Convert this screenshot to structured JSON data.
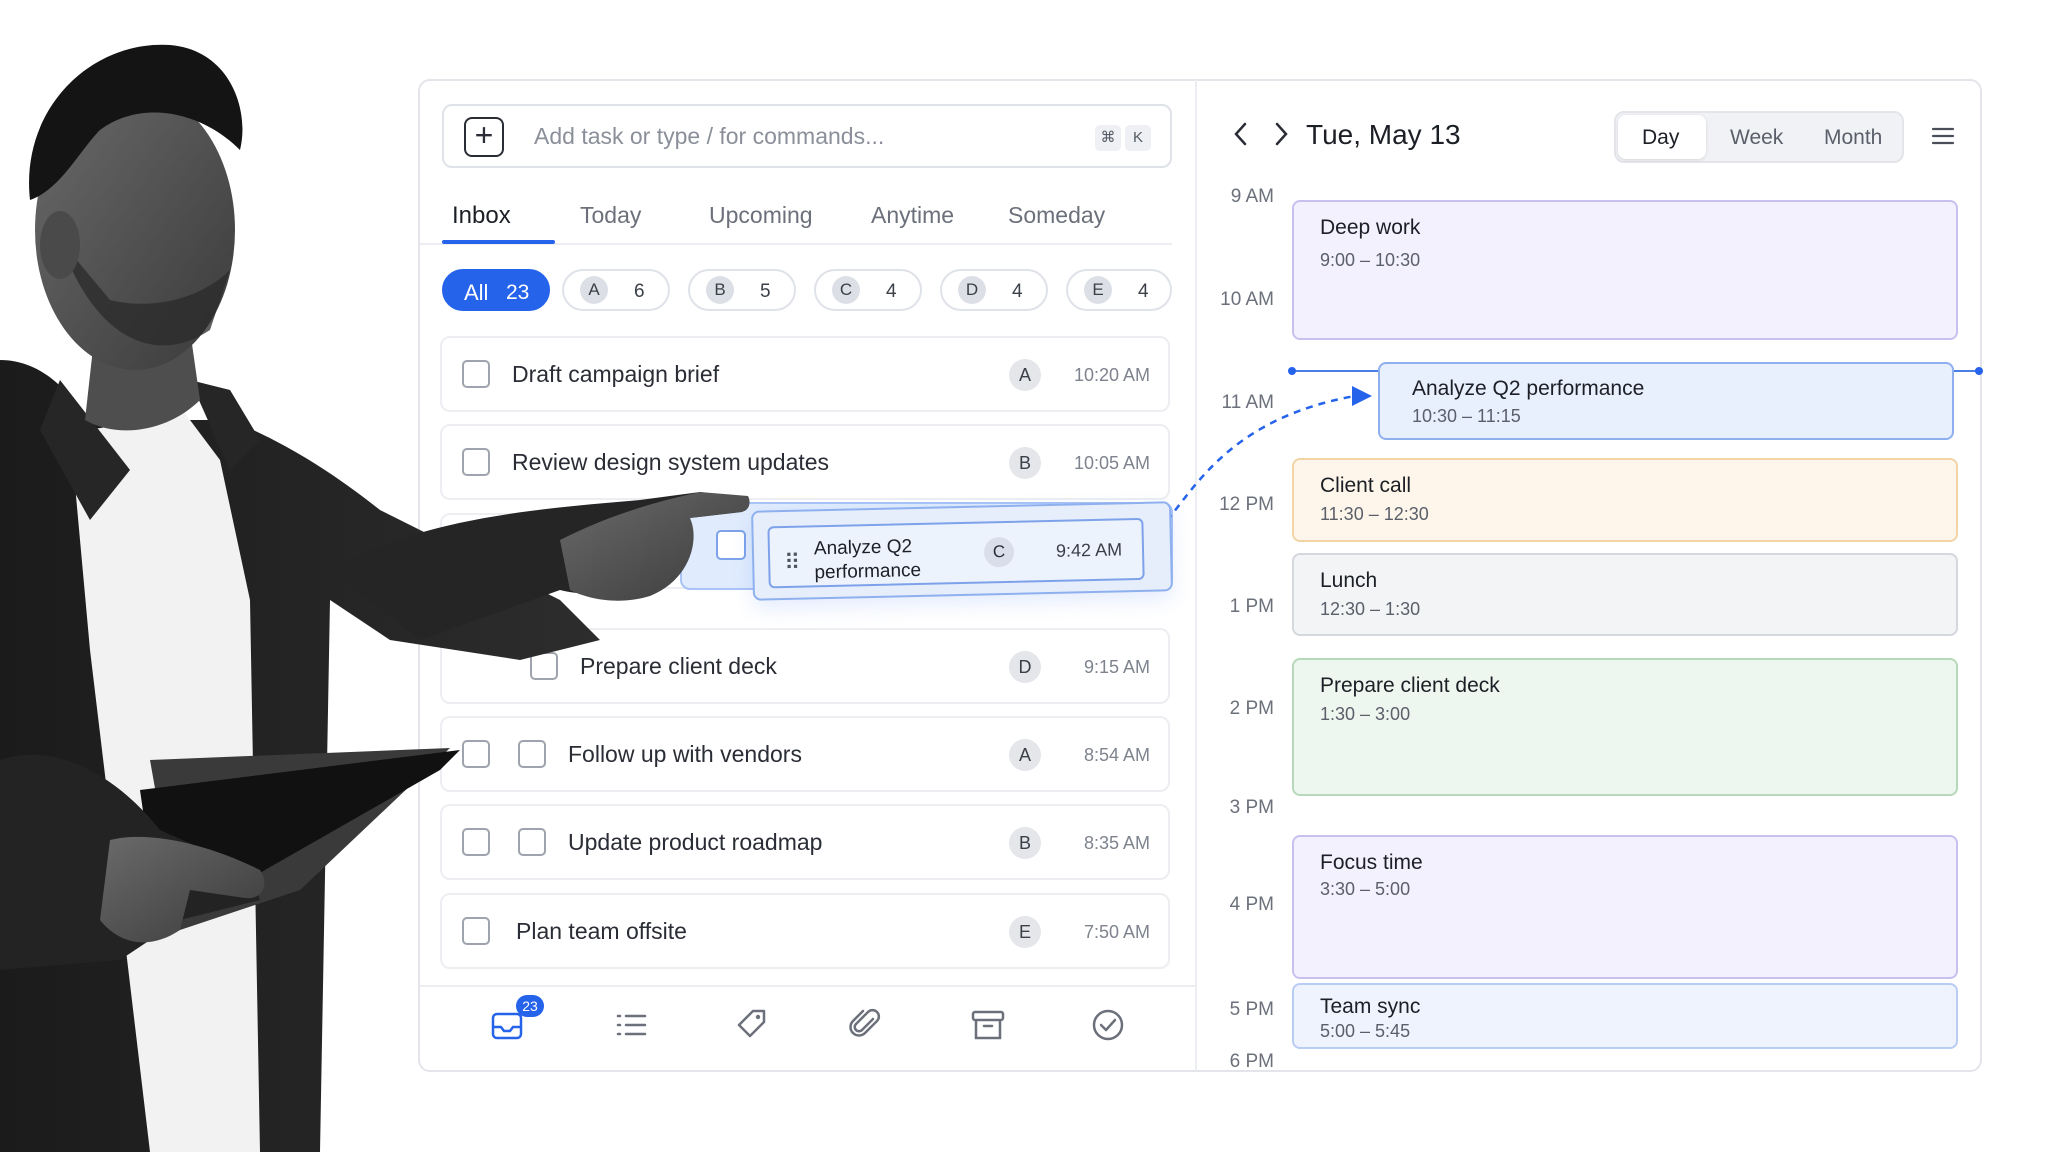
{
  "command_bar": {
    "placeholder": "Add task or type / for commands...",
    "shortcut": [
      "⌘",
      "K"
    ]
  },
  "tabs": [
    {
      "label": "Inbox",
      "active": true
    },
    {
      "label": "Today"
    },
    {
      "label": "Upcoming"
    },
    {
      "label": "Anytime"
    },
    {
      "label": "Someday"
    }
  ],
  "filters": [
    {
      "label": "All",
      "count": "23",
      "active": true
    },
    {
      "label": "A",
      "count": "6"
    },
    {
      "label": "B",
      "count": "5"
    },
    {
      "label": "C",
      "count": "4"
    },
    {
      "label": "D",
      "count": "4"
    },
    {
      "label": "E",
      "count": "4"
    }
  ],
  "tasks": [
    {
      "title": "Draft campaign brief",
      "priority": "A",
      "time": "10:20 AM"
    },
    {
      "title": "Review design system updates",
      "priority": "B",
      "time": "10:05 AM"
    },
    {
      "title": "Prepare client deck",
      "priority": "D",
      "time": "9:15 AM"
    },
    {
      "title": "Follow up with vendors",
      "priority": "A",
      "time": "8:54 AM"
    },
    {
      "title": "Update product roadmap",
      "priority": "B",
      "time": "8:35 AM"
    },
    {
      "title": "Plan team offsite",
      "priority": "E",
      "time": "7:50 AM"
    }
  ],
  "dragging_task": {
    "title": "Analyze Q2 performance",
    "priority": "C",
    "time": "9:42 AM"
  },
  "toolbar": {
    "inbox_badge": "23",
    "icons": [
      "inbox-icon",
      "list-icon",
      "tag-icon",
      "paperclip-icon",
      "archive-icon",
      "check-circle-icon"
    ]
  },
  "calendar": {
    "date": "Tue, May 13",
    "views": [
      "Day",
      "Week",
      "Month"
    ],
    "selected_view": "Day",
    "hours": [
      "9 AM",
      "10 AM",
      "11 AM",
      "12 PM",
      "1 PM",
      "2 PM",
      "3 PM",
      "4 PM",
      "5 PM",
      "6 PM"
    ],
    "events": [
      {
        "title": "Deep work",
        "time": "9:00 – 10:30",
        "color": "#c9c0f0"
      },
      {
        "title": "Analyze Q2  performance",
        "time": "10:30 – 11:15",
        "color": "#8fb0ef"
      },
      {
        "title": "Client call",
        "time": "11:30 – 12:30",
        "color": "#f2d4a6"
      },
      {
        "title": "Lunch",
        "time": "12:30 – 1:30",
        "color": "#d4d7dd"
      },
      {
        "title": "Prepare client deck",
        "time": "1:30 – 3:00",
        "color": "#b5d9b9"
      },
      {
        "title": "Focus time",
        "time": "3:30 – 5:00",
        "color": "#c9c0f0"
      },
      {
        "title": "Team sync",
        "time": "5:00 – 5:45",
        "color": "#b9ccf3"
      }
    ]
  },
  "colors": {
    "accent": "#2563eb"
  }
}
